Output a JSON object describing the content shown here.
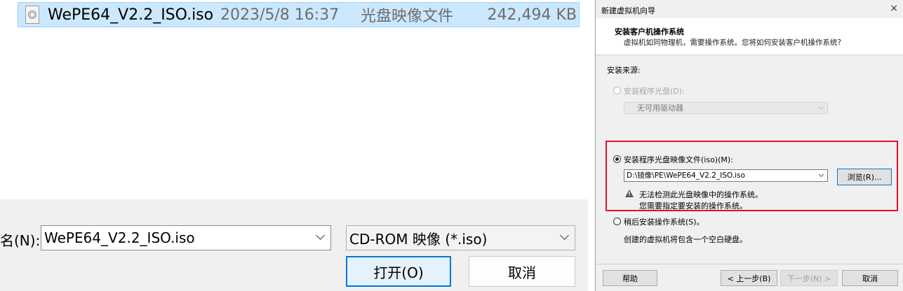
{
  "file_dialog": {
    "file": {
      "name": "WePE64_V2.2_ISO.iso",
      "date": "2023/5/8 16:37",
      "type": "光盘映像文件",
      "size": "242,494 KB"
    },
    "filename_label": "名(N):",
    "filename_value": "WePE64_V2.2_ISO.iso",
    "filter_value": "CD-ROM 映像 (*.iso)",
    "open_button": "打开(O)",
    "cancel_button": "取消"
  },
  "wizard": {
    "window_title": "新建虚拟机向导",
    "close_glyph": "×",
    "header_title": "安装客户机操作系统",
    "header_subtitle": "虚拟机如同物理机，需要操作系统。您将如何安装客户机操作系统?",
    "source_label": "安装来源:",
    "option_disc": {
      "label": "安装程序光盘(D):",
      "checked": false,
      "enabled": false
    },
    "drive_value": "无可用驱动器",
    "option_iso": {
      "label": "安装程序光盘映像文件(iso)(M):",
      "checked": true,
      "enabled": true
    },
    "iso_path": "D:\\镜像\\PE\\WePE64_V2.2_ISO.iso",
    "browse_button": "浏览(R)...",
    "warning_line1": "无法检测此光盘映像中的操作系统。",
    "warning_line2": "您需要指定要安装的操作系统。",
    "option_later": {
      "label": "稍后安装操作系统(S)。",
      "checked": false,
      "enabled": true
    },
    "later_desc": "创建的虚拟机将包含一个空白硬盘。",
    "help_button": "帮助",
    "back_button": "< 上一步(B)",
    "next_button": "下一步(N) >",
    "cancel_button": "取消",
    "highlight_color": "#e81123"
  }
}
